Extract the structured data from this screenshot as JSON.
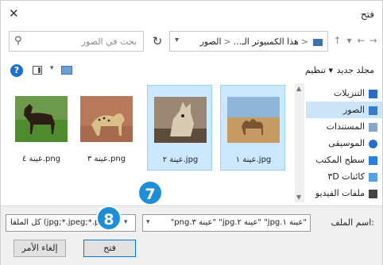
{
  "window": {
    "title": "فتح"
  },
  "search": {
    "placeholder": "بحث في الصور"
  },
  "address": {
    "root": "هذا الكمبيوتر الـ...",
    "current": "الصور"
  },
  "toolbar": {
    "organize": "تنظيم ▾",
    "new_folder": "مجلد جديد"
  },
  "sidebar": {
    "items": [
      {
        "label": "التنزيلات",
        "icon": "downloads-icon",
        "color": "#2b6cc4",
        "selected": false
      },
      {
        "label": "الصور",
        "icon": "pictures-icon",
        "color": "#3c7ac7",
        "selected": true
      },
      {
        "label": "المستندات",
        "icon": "documents-icon",
        "color": "#8aa6c8",
        "selected": false
      },
      {
        "label": "الموسيقى",
        "icon": "music-icon",
        "color": "#2b6cc4",
        "selected": false
      },
      {
        "label": "سطح المكتب",
        "icon": "desktop-icon",
        "color": "#2b7fd6",
        "selected": false
      },
      {
        "label": "كائنات ثلاثية الأبعاد",
        "display": "كائنات ٣D",
        "icon": "3d-objects-icon",
        "color": "#5aa0e0",
        "selected": false
      },
      {
        "label": "ملفات الفيديو",
        "icon": "videos-icon",
        "color": "#444444",
        "selected": false
      }
    ]
  },
  "files": [
    {
      "name": "عينة ١.jpg",
      "thumb": "camel-desert",
      "selected": true
    },
    {
      "name": "عينة ٢.jpg",
      "thumb": "wild-dog",
      "selected": true
    },
    {
      "name": "عينة ٣.png",
      "thumb": "cheetah",
      "selected": false
    },
    {
      "name": "عينة ٤.png",
      "thumb": "horse",
      "selected": false
    }
  ],
  "bottom": {
    "file_name_label": "اسم الملف:",
    "file_name_value": "\"عينة ١.jpg\" \"عينة ٢.jpg\" \"عينة ٣.png\"",
    "file_type_value": "(*.jpg;*.jpeg;*.png) كل الملفات",
    "open_label": "فتح",
    "cancel_label": "إلغاء الأمر"
  },
  "callouts": {
    "step7": "7",
    "step8": "8"
  },
  "colors": {
    "accent": "#1e8fd6",
    "selection": "#cce8ff",
    "nav_selected": "#cce4f7"
  }
}
